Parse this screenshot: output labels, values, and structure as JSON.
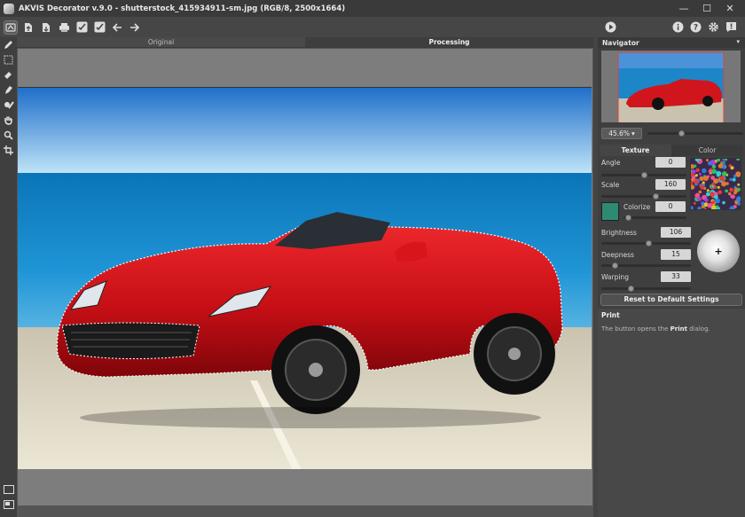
{
  "window": {
    "title": "AKVIS Decorator v.9.0 - shutterstock_415934911-sm.jpg (RGB/8, 2500x1664)",
    "minimize_glyph": "—",
    "maximize_glyph": "☐",
    "close_glyph": "✕"
  },
  "toolbar": {
    "left_icons": [
      "home-icon",
      "open-file-icon",
      "save-file-icon",
      "print-icon",
      "brush-check-icon",
      "brush-check-alt-icon",
      "undo-arrow-icon",
      "redo-arrow-icon"
    ],
    "run_icon": "play-icon",
    "right_icons": [
      "info-icon",
      "help-icon",
      "settings-gear-icon",
      "notification-icon"
    ]
  },
  "tools": [
    "pencil-icon",
    "selection-rect-icon",
    "eraser-icon",
    "stamp-icon",
    "chain-brush-icon",
    "hand-icon",
    "zoom-icon",
    "crop-icon"
  ],
  "canvas": {
    "tabs": [
      {
        "label": "Original",
        "active": false
      },
      {
        "label": "Processing",
        "active": true
      }
    ]
  },
  "navigator": {
    "title": "Navigator",
    "zoom": "45.6%",
    "zoom_arrow": "▾",
    "zoom_slider_fraction": 0.36
  },
  "settings": {
    "tabs": [
      {
        "label": "Texture",
        "active": true
      },
      {
        "label": "Color",
        "active": false
      }
    ],
    "angle": {
      "label": "Angle",
      "value": "0",
      "slider_fraction": 0.5
    },
    "scale": {
      "label": "Scale",
      "value": "160",
      "slider_fraction": 0.64
    },
    "colorize": {
      "label": "Colorize",
      "value": "0",
      "slider_fraction": 0.08,
      "swatch_color": "#2f8a74"
    },
    "brightness": {
      "label": "Brightness",
      "value": "106",
      "slider_fraction": 0.53
    },
    "deepness": {
      "label": "Deepness",
      "value": "15",
      "slider_fraction": 0.15
    },
    "warping": {
      "label": "Warping",
      "value": "33",
      "slider_fraction": 0.33
    },
    "light_symbol": "+",
    "reset_label": "Reset to Default Settings"
  },
  "help": {
    "title": "Print",
    "text_before": "The button opens the ",
    "text_bold": "Print",
    "text_after": " dialog."
  }
}
